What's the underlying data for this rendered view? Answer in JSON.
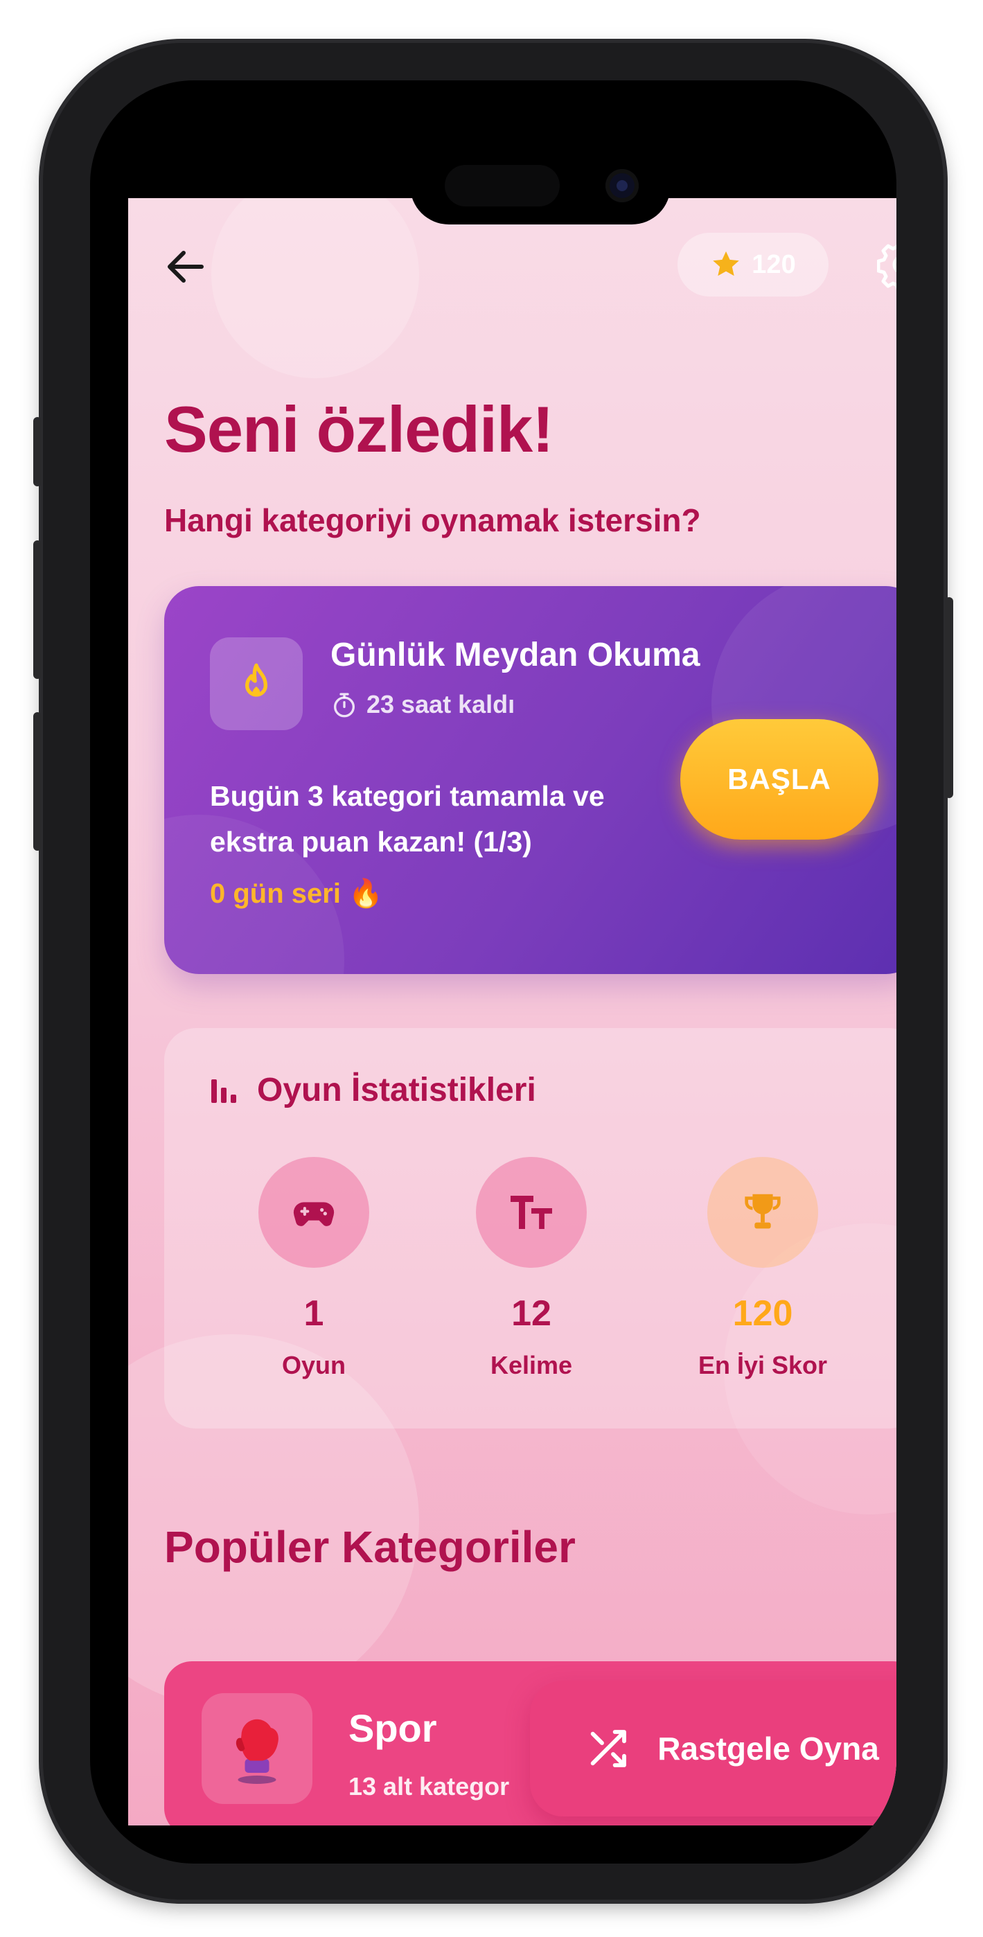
{
  "header": {
    "back_icon": "arrow-left-icon",
    "score": "120",
    "score_icon": "star-icon",
    "settings_icon": "gear-icon"
  },
  "greeting": {
    "title": "Seni özledik!",
    "subtitle": "Hangi kategoriyi oynamak istersin?"
  },
  "daily_challenge": {
    "icon": "fire-icon",
    "title": "Günlük Meydan Okuma",
    "time_left": "23 saat kaldı",
    "description": "Bugün 3 kategori tamamla ve ekstra puan kazan! (1/3)",
    "streak": "0 gün seri 🔥",
    "start_label": "BAŞLA"
  },
  "stats": {
    "title": "Oyun İstatistikleri",
    "items": [
      {
        "icon": "gamepad-icon",
        "value": "1",
        "label": "Oyun"
      },
      {
        "icon": "text-size-icon",
        "value": "12",
        "label": "Kelime"
      },
      {
        "icon": "trophy-icon",
        "value": "120",
        "label": "En İyi Skor"
      }
    ]
  },
  "popular": {
    "title": "Popüler Kategoriler",
    "categories": [
      {
        "name": "Spor",
        "subtitle": "13 alt kategor",
        "icon": "boxing-glove-icon"
      }
    ]
  },
  "random_button": {
    "label": "Rastgele Oyna",
    "icon": "shuffle-icon"
  },
  "colors": {
    "primary_text": "#b0124f",
    "accent_orange": "#ffa81a",
    "category_pink": "#ec4583",
    "challenge_purple": "#7c3dbc"
  }
}
